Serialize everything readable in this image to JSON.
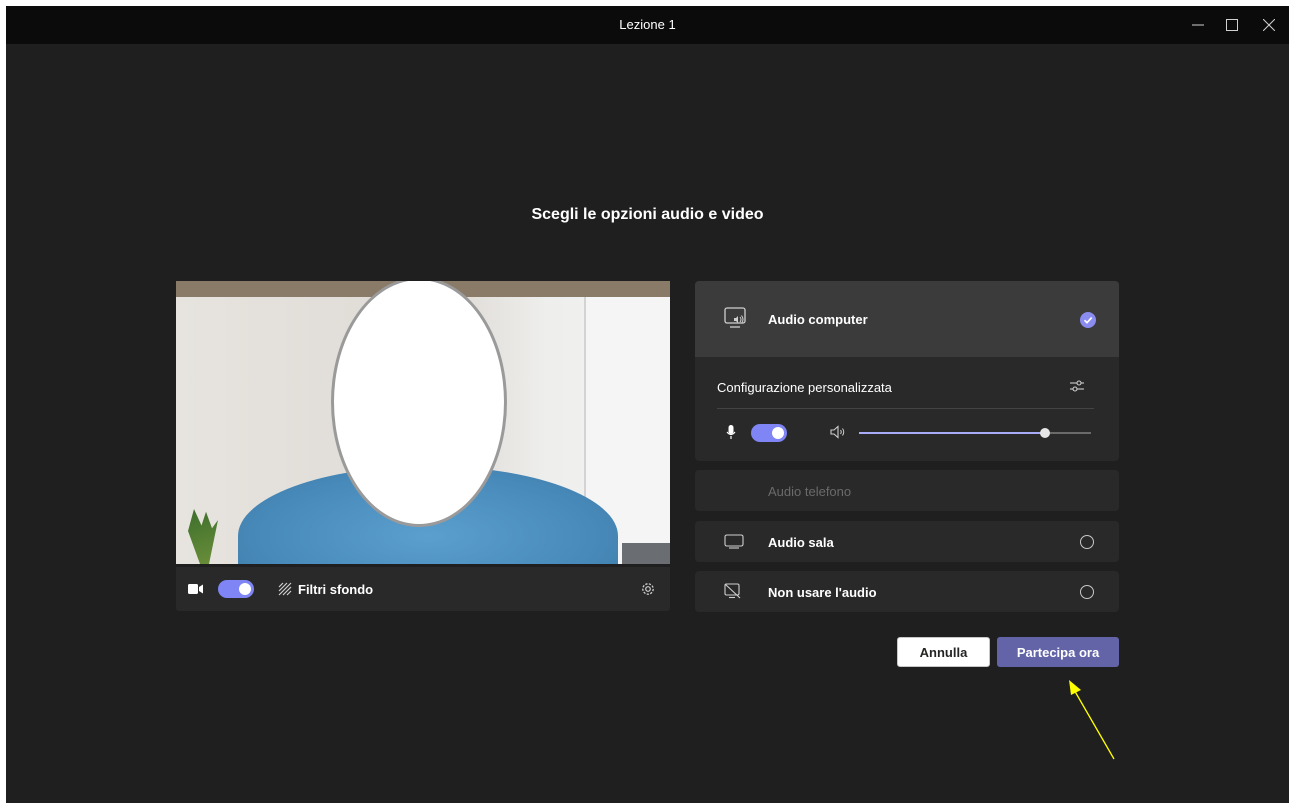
{
  "window": {
    "title": "Lezione 1"
  },
  "heading": "Scegli le opzioni audio e video",
  "video_bar": {
    "background_filters_label": "Filtri sfondo",
    "camera_on": true
  },
  "audio_options": {
    "computer_audio": {
      "label": "Audio computer",
      "selected": true,
      "config_label": "Configurazione personalizzata",
      "mic_on": true,
      "speaker_volume": 0.8
    },
    "phone_audio": {
      "label": "Audio telefono",
      "disabled": true
    },
    "room_audio": {
      "label": "Audio sala",
      "selected": false
    },
    "no_audio": {
      "label": "Non usare l'audio",
      "selected": false
    }
  },
  "actions": {
    "cancel_label": "Annulla",
    "join_label": "Partecipa ora"
  },
  "colors": {
    "accent": "#6264a7",
    "toggle": "#7f85f5",
    "background": "#1f1f1f",
    "panel": "#292929",
    "annotation_arrow": "#ffff00"
  }
}
